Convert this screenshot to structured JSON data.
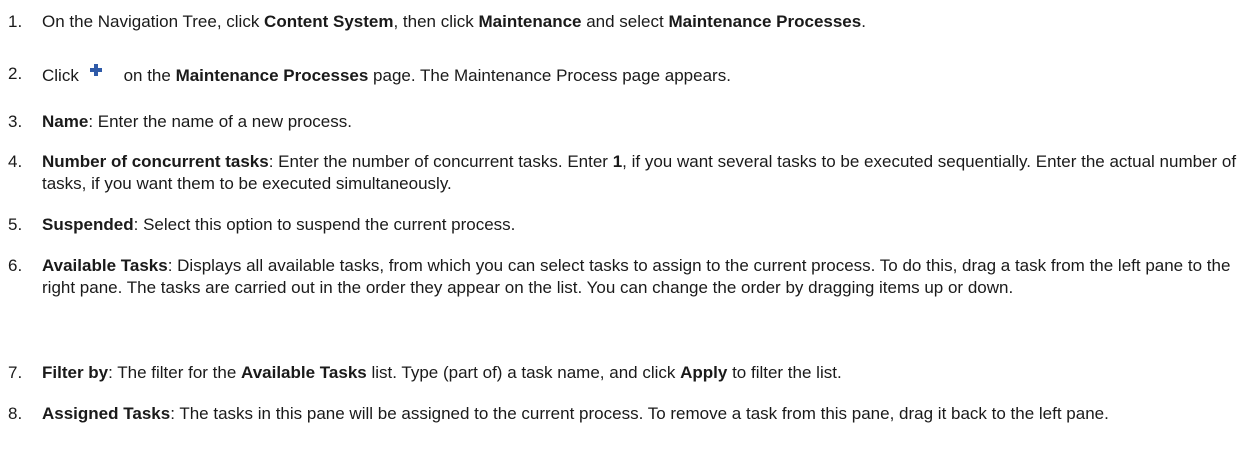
{
  "steps": [
    {
      "num": "1.",
      "parts": [
        {
          "t": "On the Navigation Tree, click "
        },
        {
          "t": "Content System",
          "b": true
        },
        {
          "t": ", then click "
        },
        {
          "t": "Maintenance",
          "b": true
        },
        {
          "t": " and select "
        },
        {
          "t": "Maintenance Processes",
          "b": true
        },
        {
          "t": "."
        }
      ]
    },
    {
      "num": "2.",
      "parts": [
        {
          "t": "Click"
        },
        {
          "icon": "add-icon"
        },
        {
          "t": " on the "
        },
        {
          "t": "Maintenance Processes",
          "b": true
        },
        {
          "t": " page. The Maintenance Process page appears."
        }
      ]
    },
    {
      "num": "3.",
      "parts": [
        {
          "t": "Name",
          "b": true
        },
        {
          "t": ": Enter the name of a new process."
        }
      ]
    },
    {
      "num": "4.",
      "parts": [
        {
          "t": "Number of concurrent tasks",
          "b": true
        },
        {
          "t": ": Enter the number of concurrent tasks. Enter "
        },
        {
          "t": "1",
          "b": true
        },
        {
          "t": ", if you want several tasks to be executed sequentially. Enter the actual number of tasks, if you want them to be executed simultaneously."
        }
      ]
    },
    {
      "num": "5.",
      "parts": [
        {
          "t": "Suspended",
          "b": true
        },
        {
          "t": ": Select this option to suspend the current process."
        }
      ]
    },
    {
      "num": "6.",
      "parts": [
        {
          "t": "Available Tasks",
          "b": true
        },
        {
          "t": ": Displays all available tasks, from which you can select tasks to assign to the current process. To do this, drag a task from the left pane to the right pane. The tasks are carried out in the order they appear on the list. You can change the order by dragging items up or down."
        }
      ]
    },
    {
      "num": "7.",
      "parts": [
        {
          "t": "Filter by",
          "b": true
        },
        {
          "t": ": The filter for the "
        },
        {
          "t": "Available Tasks",
          "b": true
        },
        {
          "t": " list. Type (part of) a task name, and click "
        },
        {
          "t": "Apply",
          "b": true
        },
        {
          "t": " to filter the list."
        }
      ]
    },
    {
      "num": "8.",
      "parts": [
        {
          "t": "Assigned Tasks",
          "b": true
        },
        {
          "t": ": The tasks in this pane will be assigned to the current process. To remove a task from this pane, drag it back to the left pane."
        }
      ]
    }
  ]
}
